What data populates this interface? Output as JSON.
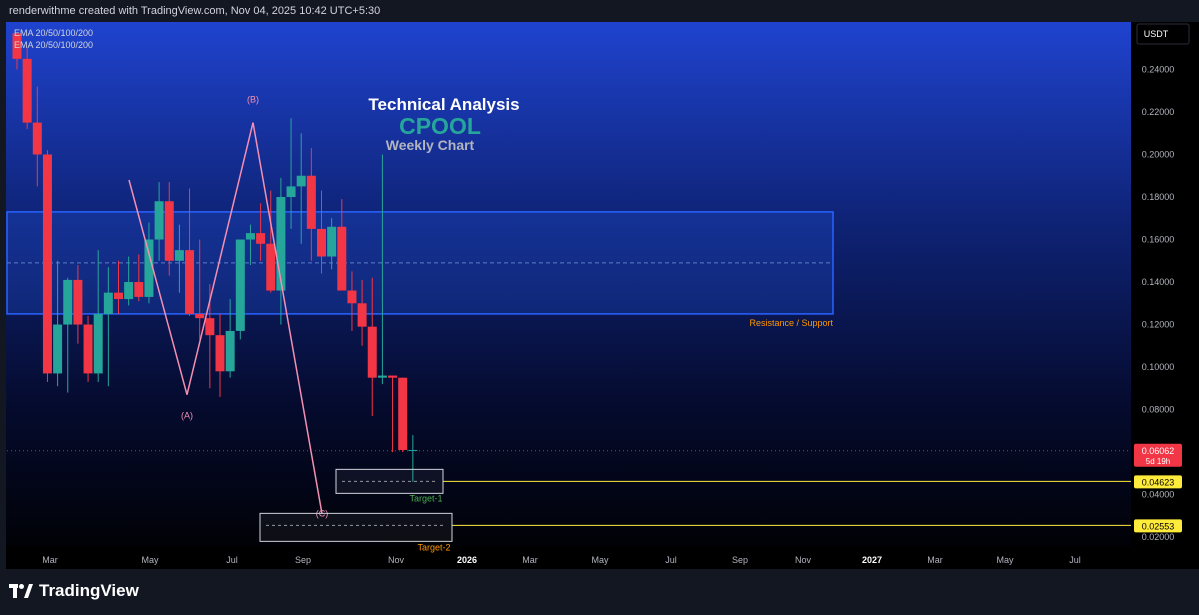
{
  "header": {
    "created_text": "renderwithme created with TradingView.com, Nov 04, 2025 10:42 UTC+5:30"
  },
  "brand": {
    "name": "TradingView"
  },
  "indicators": [
    "EMA 20/50/100/200",
    "EMA 20/50/100/200"
  ],
  "currency": "USDT",
  "title": {
    "line1": "Technical Analysis",
    "line2": "CPOOL",
    "line3": "Weekly Chart"
  },
  "colors": {
    "up": "#26a69a",
    "down": "#f23645",
    "zone": "#2962ff",
    "wave": "#f48fb1",
    "target": "#ffeb3b",
    "resistance_text": "#ff9800"
  },
  "chart_data": {
    "type": "candlestick",
    "y_ticks": [
      "0.24000",
      "0.22000",
      "0.20000",
      "0.18000",
      "0.16000",
      "0.14000",
      "0.12000",
      "0.10000",
      "0.08000",
      "0.04000",
      "0.02000"
    ],
    "x_ticks": [
      "Mar",
      "May",
      "Jul",
      "Sep",
      "Nov",
      "2026",
      "Mar",
      "May",
      "Jul",
      "Sep",
      "Nov",
      "2027",
      "Mar",
      "May",
      "Jul"
    ],
    "ylim": [
      0.005,
      0.257
    ],
    "last_price": {
      "value": "0.06062",
      "countdown": "5d 19h"
    },
    "zone": {
      "label": "Resistance / Support",
      "top": 0.173,
      "bottom": 0.125,
      "mid": 0.149
    },
    "targets": [
      {
        "label": "Target-1",
        "price": "0.04623"
      },
      {
        "label": "Target-2",
        "price": "0.02553"
      }
    ],
    "waves": [
      {
        "label": "(A)",
        "price": 0.087
      },
      {
        "label": "(B)",
        "price": 0.215
      },
      {
        "label": "(C)",
        "price": 0.031
      }
    ],
    "candles": [
      [
        0.257,
        0.257,
        0.24,
        0.245
      ],
      [
        0.245,
        0.25,
        0.212,
        0.215
      ],
      [
        0.215,
        0.232,
        0.185,
        0.2
      ],
      [
        0.2,
        0.202,
        0.093,
        0.097
      ],
      [
        0.097,
        0.15,
        0.091,
        0.12
      ],
      [
        0.12,
        0.142,
        0.088,
        0.141
      ],
      [
        0.141,
        0.148,
        0.111,
        0.12
      ],
      [
        0.12,
        0.124,
        0.093,
        0.097
      ],
      [
        0.097,
        0.155,
        0.093,
        0.125
      ],
      [
        0.125,
        0.147,
        0.091,
        0.135
      ],
      [
        0.135,
        0.15,
        0.125,
        0.132
      ],
      [
        0.132,
        0.152,
        0.129,
        0.14
      ],
      [
        0.14,
        0.153,
        0.131,
        0.133
      ],
      [
        0.133,
        0.168,
        0.13,
        0.16
      ],
      [
        0.16,
        0.187,
        0.15,
        0.178
      ],
      [
        0.178,
        0.187,
        0.143,
        0.15
      ],
      [
        0.15,
        0.167,
        0.135,
        0.155
      ],
      [
        0.155,
        0.184,
        0.124,
        0.125
      ],
      [
        0.125,
        0.16,
        0.113,
        0.123
      ],
      [
        0.123,
        0.139,
        0.09,
        0.115
      ],
      [
        0.115,
        0.125,
        0.086,
        0.098
      ],
      [
        0.098,
        0.132,
        0.095,
        0.117
      ],
      [
        0.117,
        0.155,
        0.113,
        0.16
      ],
      [
        0.16,
        0.167,
        0.148,
        0.163
      ],
      [
        0.163,
        0.177,
        0.15,
        0.158
      ],
      [
        0.158,
        0.183,
        0.135,
        0.136
      ],
      [
        0.136,
        0.189,
        0.12,
        0.18
      ],
      [
        0.18,
        0.217,
        0.165,
        0.185
      ],
      [
        0.185,
        0.21,
        0.158,
        0.19
      ],
      [
        0.19,
        0.203,
        0.15,
        0.165
      ],
      [
        0.165,
        0.183,
        0.144,
        0.152
      ],
      [
        0.152,
        0.17,
        0.146,
        0.166
      ],
      [
        0.166,
        0.179,
        0.136,
        0.136
      ],
      [
        0.136,
        0.145,
        0.117,
        0.13
      ],
      [
        0.13,
        0.141,
        0.11,
        0.119
      ],
      [
        0.119,
        0.142,
        0.077,
        0.095
      ],
      [
        0.095,
        0.2,
        0.092,
        0.096
      ],
      [
        0.096,
        0.096,
        0.06,
        0.095
      ],
      [
        0.095,
        0.095,
        0.06,
        0.061
      ],
      [
        0.061,
        0.068,
        0.046,
        0.061
      ]
    ]
  }
}
